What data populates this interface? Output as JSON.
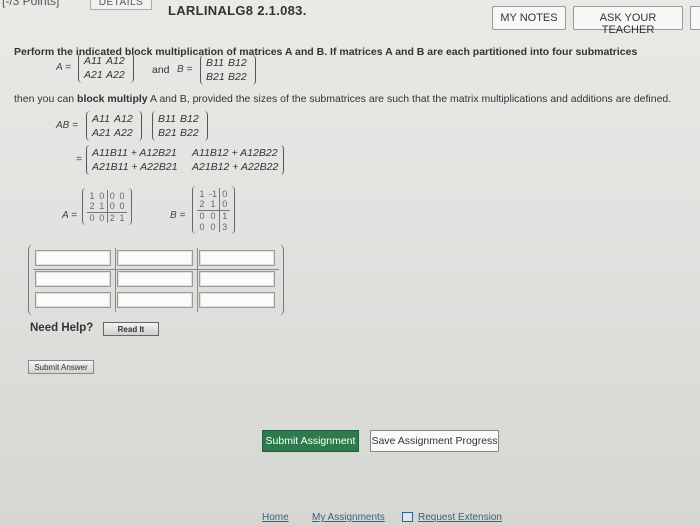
{
  "header": {
    "points": "[-/3 Points]",
    "details_tab": "DETAILS",
    "question_id": "LARLINALG8 2.1.083.",
    "my_notes": "MY NOTES",
    "ask_teacher": "ASK YOUR TEACHER"
  },
  "problem": {
    "intro": "Perform the indicated block multiplication of matrices A and B. If matrices A and B are each partitioned into four submatrices",
    "a_label": "A =",
    "and": "and",
    "b_label": "B =",
    "a_block": [
      [
        "A11",
        "A12"
      ],
      [
        "A21",
        "A22"
      ]
    ],
    "b_block": [
      [
        "B11",
        "B12"
      ],
      [
        "B21",
        "B22"
      ]
    ],
    "then_prefix": "then you can ",
    "then_bold": "block multiply",
    "then_suffix": " A and B, provided the sizes of the submatrices are such that the matrix multiplications and additions are defined.",
    "ab_label": "AB =",
    "eq": "=",
    "product": [
      [
        "A11B11 + A12B21",
        "A11B12 + A12B22"
      ],
      [
        "A21B11 + A22B21",
        "A21B12 + A22B22"
      ]
    ],
    "numeric_a_label": "A =",
    "numeric_b_label": "B =",
    "numeric_a": [
      [
        "1",
        "0",
        "0",
        "0"
      ],
      [
        "2",
        "1",
        "0",
        "0"
      ],
      [
        "0",
        "0",
        "2",
        "1"
      ]
    ],
    "numeric_b": [
      [
        "1",
        "-1",
        "0"
      ],
      [
        "2",
        "1",
        "0"
      ],
      [
        "0",
        "0",
        "1"
      ],
      [
        "0",
        "0",
        "3"
      ]
    ]
  },
  "answer": {
    "rows": 3,
    "cols": 3,
    "values": [
      "",
      "",
      "",
      "",
      "",
      "",
      "",
      "",
      ""
    ]
  },
  "help": {
    "need_help": "Need Help?",
    "read_it": "Read It"
  },
  "actions": {
    "submit_answer": "Submit Answer",
    "submit_assignment": "Submit Assignment",
    "save_progress": "Save Assignment Progress"
  },
  "footer": {
    "home": "Home",
    "my_assignments": "My Assignments",
    "request_extension": "Request Extension"
  },
  "colors": {
    "submit_assignment_bg": "#2f7a4d",
    "link": "#3a5f8a"
  }
}
